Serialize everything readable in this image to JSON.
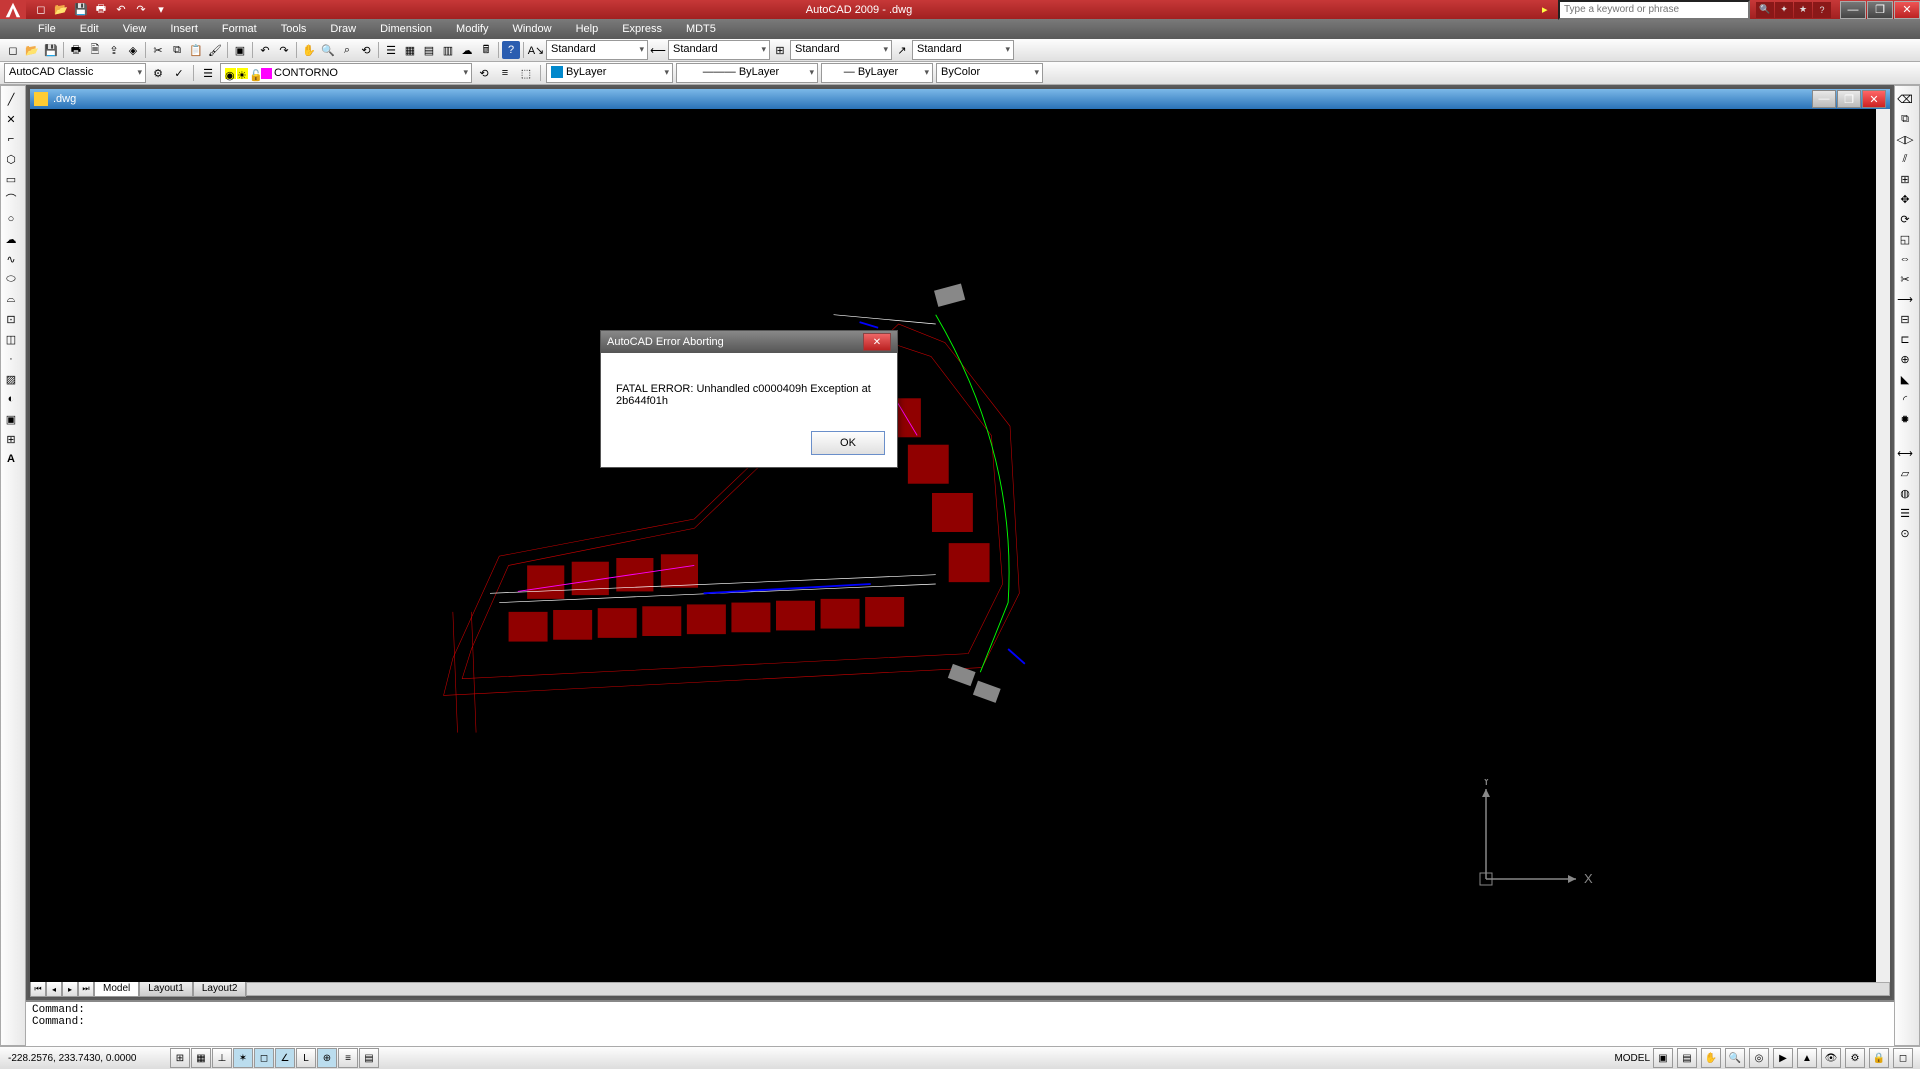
{
  "title": {
    "app": "AutoCAD 2009",
    "file": ".dwg"
  },
  "search_placeholder": "Type a keyword or phrase",
  "menu": [
    "File",
    "Edit",
    "View",
    "Insert",
    "Format",
    "Tools",
    "Draw",
    "Dimension",
    "Modify",
    "Window",
    "Help",
    "Express",
    "MDT5"
  ],
  "toolbar1": {
    "styles": [
      "Standard",
      "Standard",
      "Standard",
      "Standard"
    ]
  },
  "toolbar2": {
    "workspace": "AutoCAD Classic",
    "layer": "CONTORNO",
    "linetype": "ByLayer",
    "lineweight": "ByLayer",
    "bylayer": "ByLayer",
    "plotstyle": "ByColor"
  },
  "doc": {
    "name": ".dwg"
  },
  "tabs": [
    "Model",
    "Layout1",
    "Layout2"
  ],
  "active_tab": "Model",
  "command": {
    "line1": "Command:",
    "line2": "Command:"
  },
  "status": {
    "coords": "-228.2576, 233.7430, 0.0000",
    "mode": "MODEL"
  },
  "dialog": {
    "title": "AutoCAD Error Aborting",
    "message": "FATAL ERROR:  Unhandled c0000409h Exception at 2b644f01h",
    "ok": "OK"
  },
  "ucs": {
    "x": "X",
    "y": "Y"
  }
}
